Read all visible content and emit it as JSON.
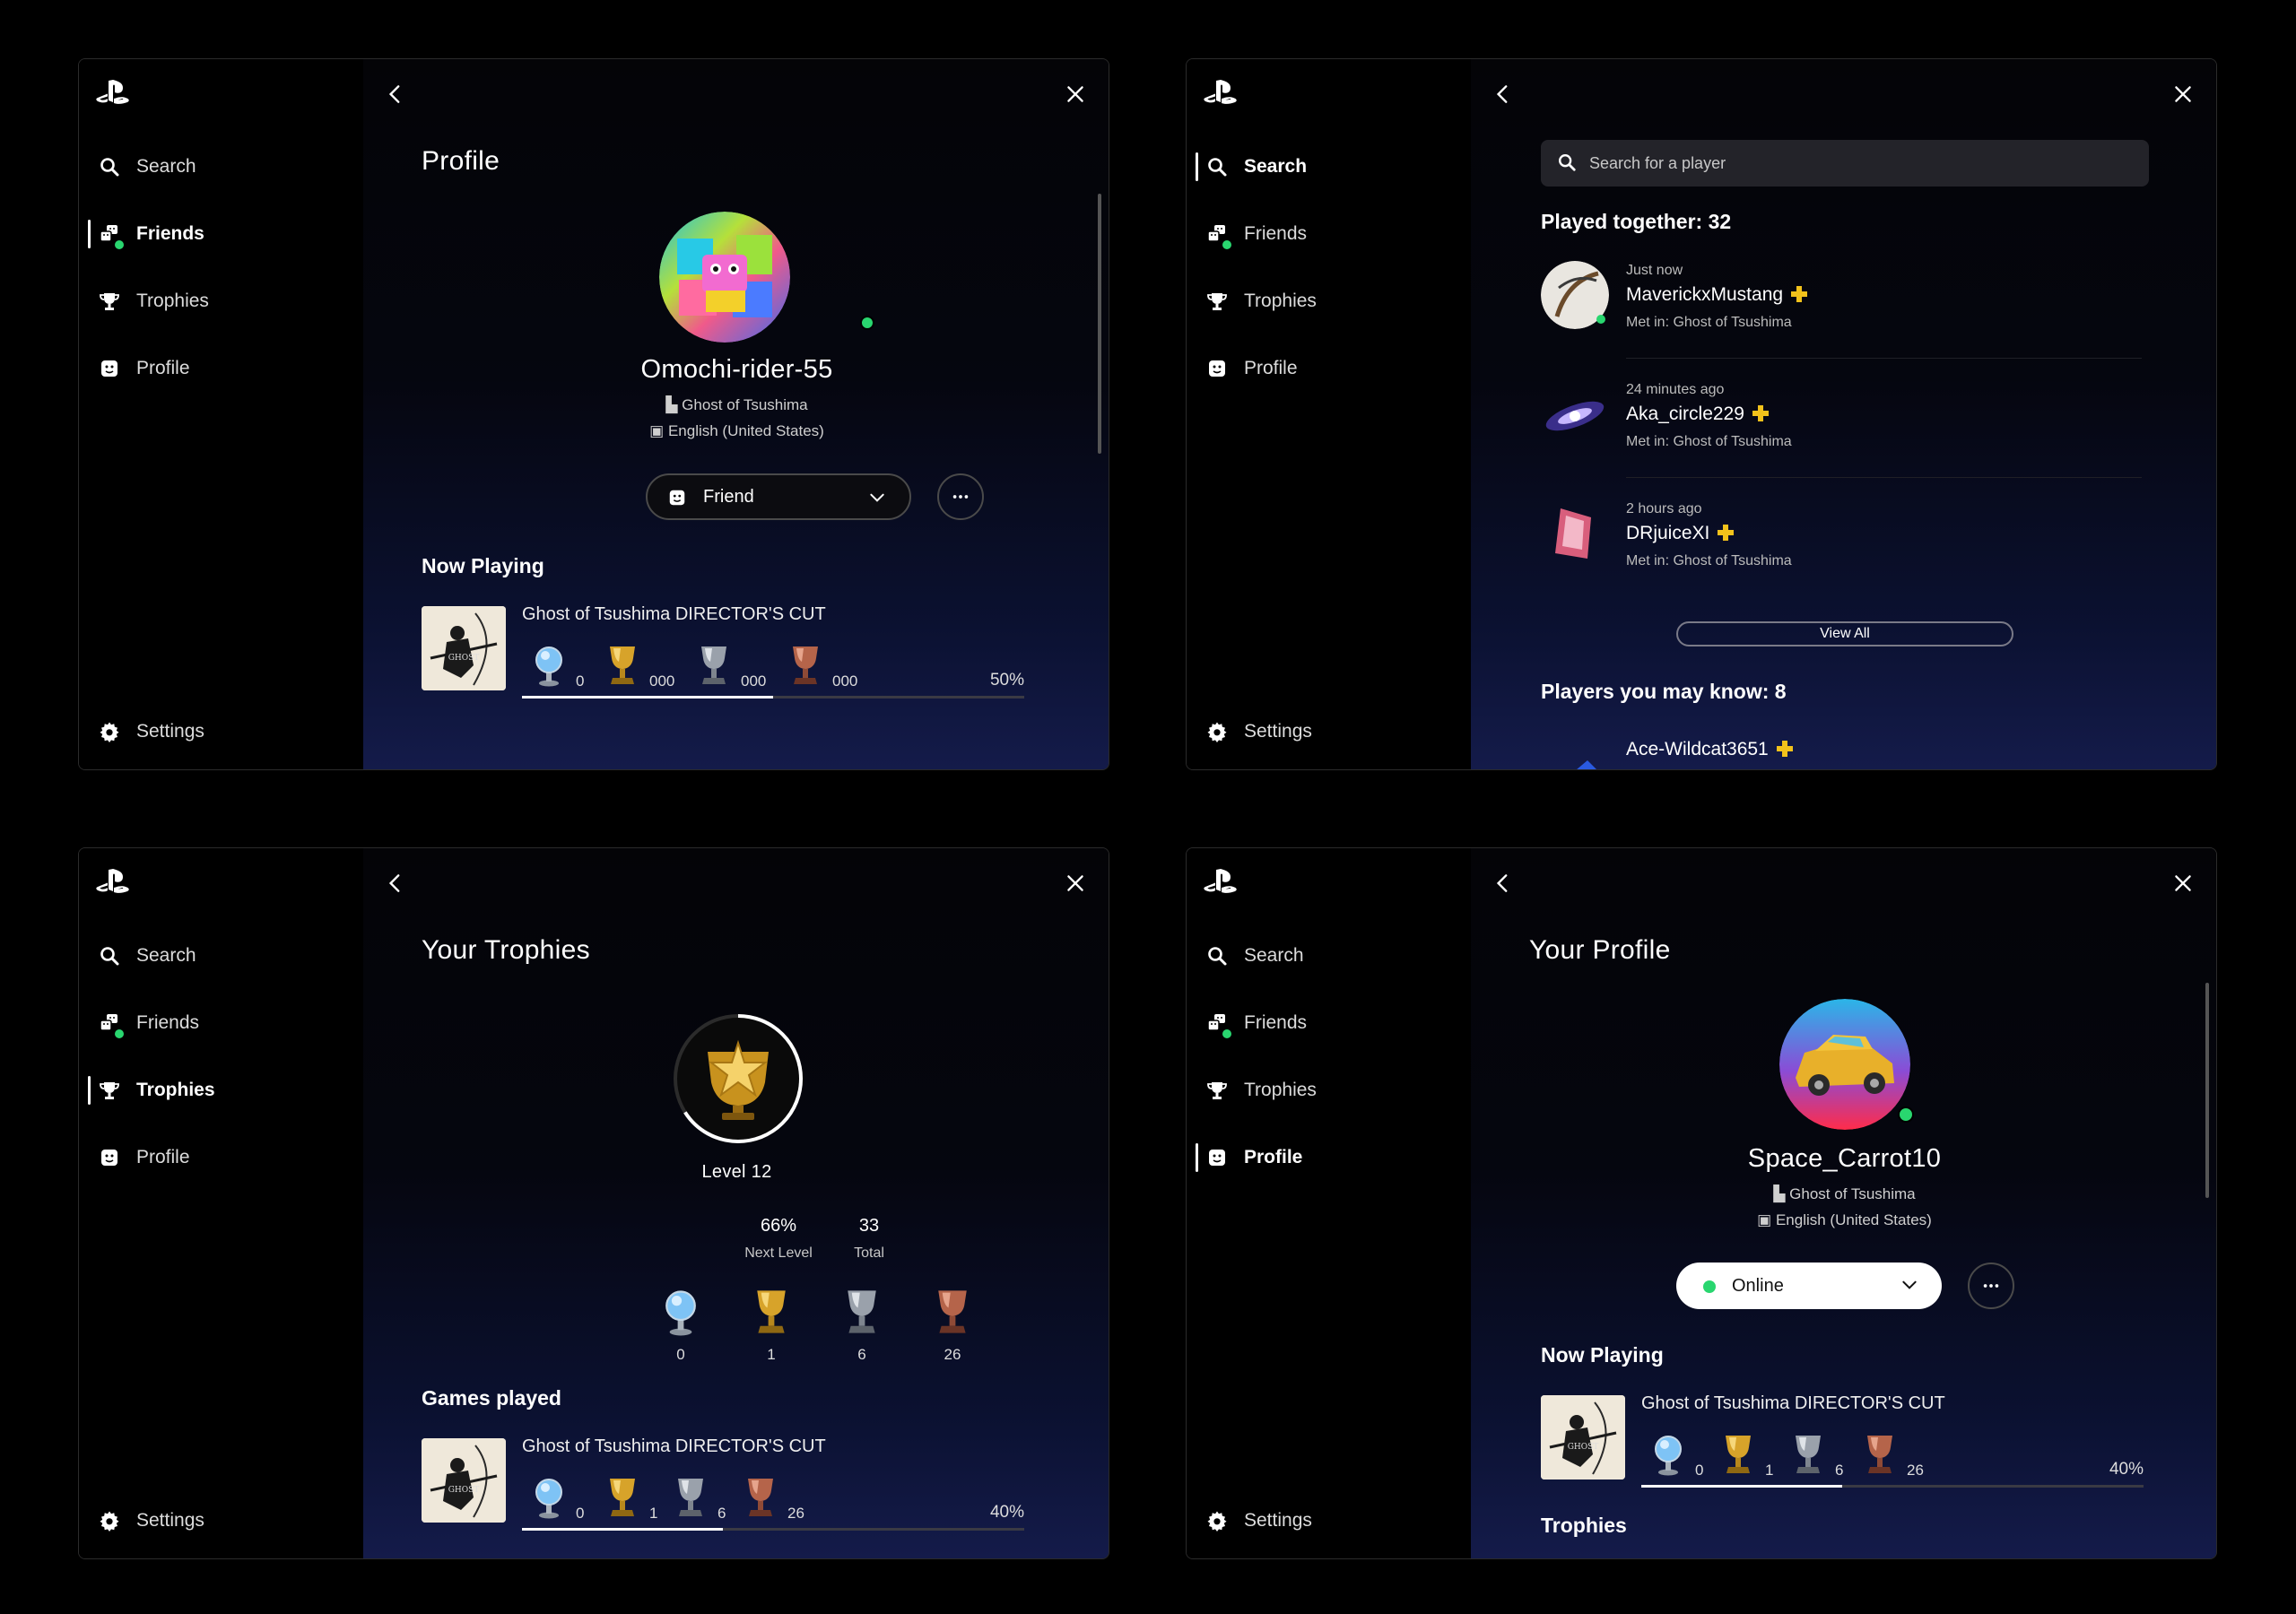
{
  "colors": {
    "online_green": "#29d66f",
    "plus_gold": "#f2c21b",
    "gold": "#d7a32a",
    "silver": "#9aa1ab",
    "bronze": "#b5644a",
    "platinum": "#7ec3f5"
  },
  "nav": {
    "search": "Search",
    "friends": "Friends",
    "trophies": "Trophies",
    "profile": "Profile",
    "settings": "Settings"
  },
  "icons": [
    "playstation-logo-icon",
    "back-chevron-icon",
    "close-icon",
    "search-icon",
    "friends-icon",
    "trophy-icon",
    "profile-icon",
    "gear-icon",
    "chevron-down-icon",
    "more-icon",
    "ps-plus-icon"
  ],
  "friend_profile": {
    "title": "Profile",
    "username": "Omochi-rider-55",
    "game": "Ghost of Tsushima",
    "language": "English (United States)",
    "relation_button": "Friend",
    "now_playing_heading": "Now Playing",
    "game_title": "Ghost of Tsushima DIRECTOR'S CUT",
    "trophy_counts": [
      "0",
      "000",
      "000",
      "000"
    ],
    "progress_label": "50%",
    "progress": 0.5
  },
  "search_page": {
    "placeholder": "Search for a player",
    "played_together": "Played together: 32",
    "players": [
      {
        "when": "Just now",
        "name": "MaverickxMustang",
        "met": "Met in: Ghost of Tsushima"
      },
      {
        "when": "24 minutes ago",
        "name": "Aka_circle229",
        "met": "Met in: Ghost of Tsushima"
      },
      {
        "when": "2 hours ago",
        "name": "DRjuiceXI",
        "met": "Met in: Ghost of Tsushima"
      }
    ],
    "view_all": "View All",
    "may_know": "Players you may know: 8",
    "may_know_first": "Ace-Wildcat3651"
  },
  "trophies_page": {
    "title": "Your Trophies",
    "level": "Level 12",
    "level_progress": 0.66,
    "next_level_value": "66%",
    "next_level_label": "Next Level",
    "total_value": "33",
    "total_label": "Total",
    "counts": [
      "0",
      "1",
      "6",
      "26"
    ],
    "games_played_heading": "Games played",
    "game_title": "Ghost of Tsushima DIRECTOR'S CUT",
    "game_counts": [
      "0",
      "1",
      "6",
      "26"
    ],
    "progress_label": "40%",
    "progress": 0.4
  },
  "your_profile": {
    "title": "Your Profile",
    "username": "Space_Carrot10",
    "game": "Ghost of Tsushima",
    "language": "English (United States)",
    "status_button": "Online",
    "now_playing_heading": "Now Playing",
    "game_title": "Ghost of Tsushima DIRECTOR'S CUT",
    "game_counts": [
      "0",
      "1",
      "6",
      "26"
    ],
    "progress_label": "40%",
    "progress": 0.4,
    "trophies_heading": "Trophies"
  }
}
